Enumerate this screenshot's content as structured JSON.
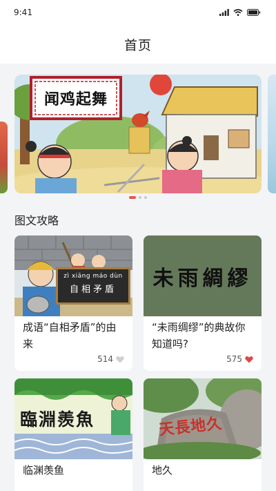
{
  "status_bar": {
    "time": "9:41"
  },
  "header": {
    "title": "首页"
  },
  "banner": {
    "slides": [
      {
        "title": "闻鸡起舞"
      }
    ],
    "active_index": 0,
    "dot_count": 3
  },
  "section": {
    "title": "图文攻略"
  },
  "articles": [
    {
      "title": "成语“自相矛盾”的由来",
      "likes": "514",
      "liked": false,
      "pinyin": "zì xiāng máo dùn",
      "idiom": "自相矛盾"
    },
    {
      "title": "“未雨绸缪”的典故你知道吗?",
      "likes": "575",
      "liked": true,
      "calligraphy": "未雨綢繆"
    },
    {
      "title": "临渊羡鱼",
      "idiom": "臨淵羨魚"
    },
    {
      "title": "地久",
      "rock_text": "天長地久"
    }
  ],
  "colors": {
    "accent": "#e2574c",
    "like_active": "#e0464a",
    "like_inactive": "#cfcfcf",
    "card_green": "#64795a"
  },
  "icons": [
    "signal-icon",
    "wifi-icon",
    "battery-icon",
    "heart-outline-icon",
    "heart-filled-icon"
  ]
}
